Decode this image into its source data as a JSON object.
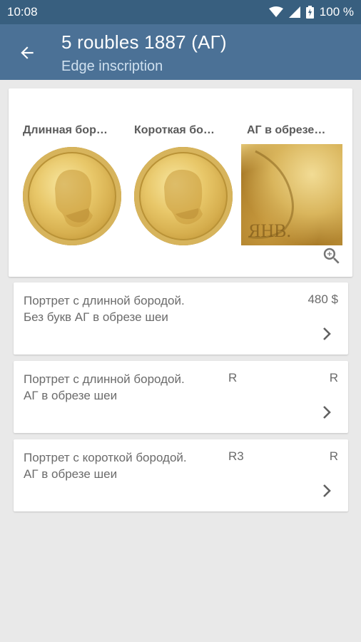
{
  "status_bar": {
    "time": "10:08",
    "battery": "100 %",
    "icons": [
      "wifi-icon",
      "signal-icon",
      "battery-icon"
    ]
  },
  "app_bar": {
    "title": "5 roubles 1887 (АГ)",
    "subtitle": "Edge inscription",
    "back_icon": "arrow-back-icon"
  },
  "gallery": {
    "items": [
      {
        "label": "Длинная бор…",
        "kind": "coin-image"
      },
      {
        "label": "Короткая бо…",
        "kind": "coin-image"
      },
      {
        "label": "АГ в обрезе…",
        "kind": "detail-image"
      }
    ],
    "zoom_icon": "zoom-in-icon"
  },
  "variants": [
    {
      "description": "Портрет с длинной бородой. Без букв АГ в обрезе шеи",
      "grade": "",
      "price": "480 $"
    },
    {
      "description": "Портрет с длинной бородой. АГ в обрезе шеи",
      "grade": "R",
      "price": "R"
    },
    {
      "description": "Портрет с короткой бородой. АГ в обрезе шеи",
      "grade": "R3",
      "price": "R"
    }
  ],
  "colors": {
    "status_bar": "#385f7f",
    "app_bar": "#4b7196",
    "background": "#e9e9e9",
    "text_muted": "#6b6b6b"
  }
}
